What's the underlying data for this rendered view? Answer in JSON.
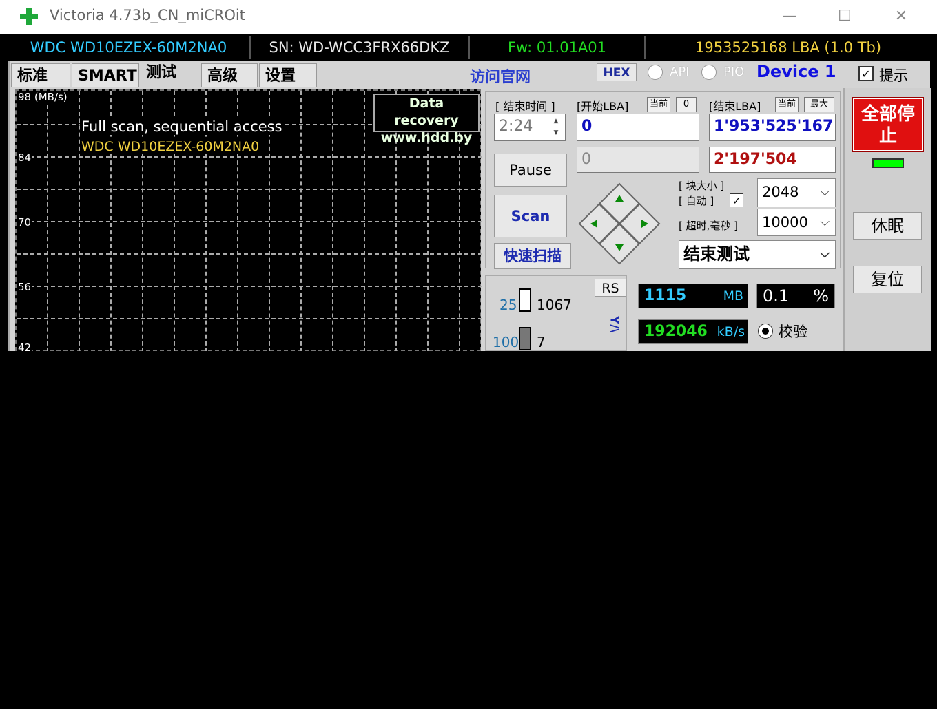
{
  "window": {
    "title": "Victoria 4.73b_CN_miCROit",
    "minimize_glyph": "—",
    "maximize_glyph": "☐",
    "close_glyph": "✕"
  },
  "infobar": {
    "model": "WDC WD10EZEX-60M2NA0",
    "serial": "SN: WD-WCC3FRX66DKZ",
    "firmware": "Fw: 01.01A01",
    "capacity": "1953525168 LBA (1.0 Tb)"
  },
  "tabs": [
    "标准",
    "SMART",
    "测试",
    "高级",
    "设置"
  ],
  "active_tab": "测试",
  "header": {
    "visit_site": "访问官网",
    "hex": "HEX",
    "api": "API",
    "pio": "PIO",
    "device": "Device 1",
    "hint": "提示"
  },
  "graph": {
    "y_labels": [
      "98 (MB/s)",
      "84",
      "70",
      "56",
      "42"
    ],
    "title_line1": "Full scan, sequential access",
    "title_line2": "WDC WD10EZEX-60M2NA0",
    "badge_line1": "Data recovery",
    "badge_line2": "www.hdd.by"
  },
  "controls": {
    "end_time_label": "[ 结束时间 ]",
    "end_time_value": "2:24",
    "start_lba_label": "[开始LBA]",
    "start_lba_btn": "当前",
    "start_lba_zero_btn": "0",
    "end_lba_label": "[结束LBA]",
    "end_lba_btn": "当前",
    "end_lba_max_btn": "最大",
    "start_lba_value": "0",
    "end_lba_value": "1'953'525'167",
    "start_lba_current": "0",
    "end_lba_current": "2'197'504",
    "pause_label": "Pause",
    "scan_label": "Scan",
    "quick_scan_label": "快速扫描",
    "block_size_label": "[ 块大小 ]",
    "auto_label": "[ 自动 ]",
    "timeout_label": "[ 超时,毫秒 ]",
    "block_size_value": "2048",
    "timeout_value": "10000",
    "end_test_value": "结束测试",
    "rs_label": "RS",
    "mb_value": "1115",
    "mb_unit": "MB",
    "percent_value": "0.1",
    "percent_unit": "%",
    "speed_value": "192046",
    "speed_unit": "kB/s",
    "verify_label": "校验",
    "bar1_label": "25",
    "bar1_count": "1067",
    "bar2_label": "100",
    "bar2_count": "7",
    "side_text": "Y/\\"
  },
  "side": {
    "stop_all": "全部停止",
    "sleep": "休眠",
    "reset": "复位"
  },
  "colors": {
    "model": "#33ccff",
    "firmware": "#22dd22",
    "capacity": "#f0d040",
    "device": "#1010e0",
    "stop_bg": "#e01010",
    "green_led": "#00ff00"
  }
}
